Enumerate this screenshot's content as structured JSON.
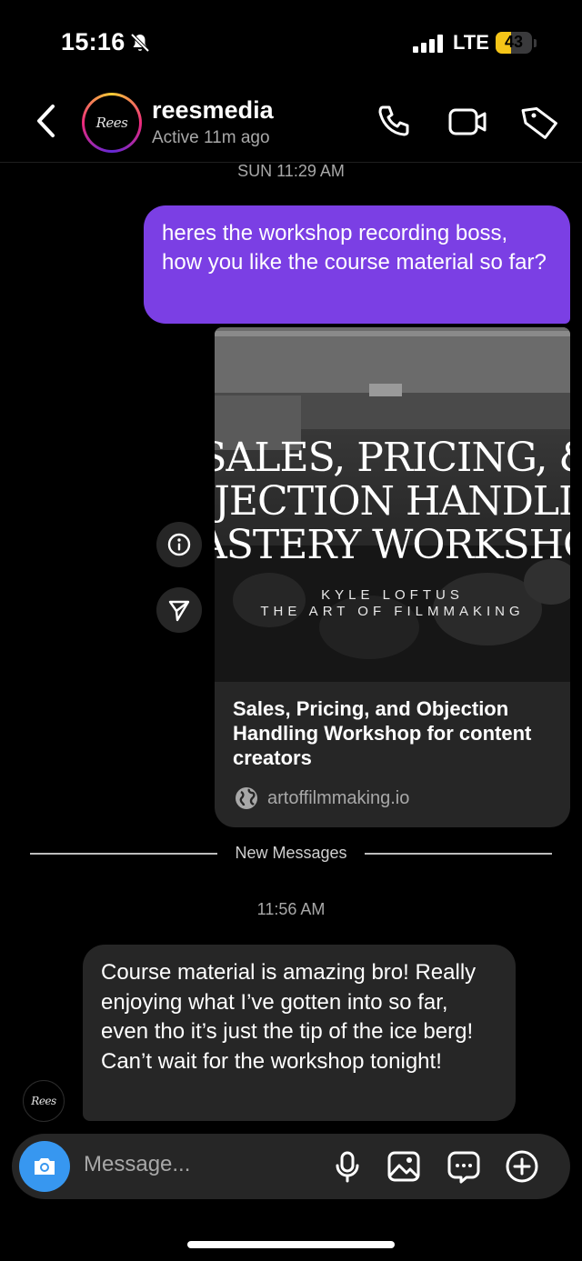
{
  "status_bar": {
    "time": "15:16",
    "network": "LTE",
    "battery": "43",
    "battery_level": 0.43
  },
  "header": {
    "name": "reesmedia",
    "status": "Active 11m ago",
    "avatar_text": "Rees"
  },
  "thread": {
    "timestamp_1": "SUN 11:29 AM",
    "sent_message": "heres the workshop recording boss, how you like the course material so far?",
    "link_card": {
      "image_title_lines": [
        "SALES, PRICING, &",
        "BJECTION HANDLIN",
        "ASTERY WORKSHO"
      ],
      "image_subtitle_1": "KYLE LOFTUS",
      "image_subtitle_2": "THE ART OF FILMMAKING",
      "title": "Sales, Pricing, and Objection Handling Workshop for content creators",
      "domain": "artoffilmmaking.io"
    },
    "new_messages_label": "New Messages",
    "timestamp_2": "11:56 AM",
    "received_message": "Course material is amazing bro! Really enjoying what I’ve gotten into so far, even tho it’s just the tip of the ice berg! Can’t wait for the workshop tonight!"
  },
  "composer": {
    "placeholder": "Message..."
  },
  "colors": {
    "sent_bubble": "#7b3fe4",
    "received_bubble": "#262626",
    "camera_button": "#3797f0",
    "battery": "#f5c518"
  }
}
